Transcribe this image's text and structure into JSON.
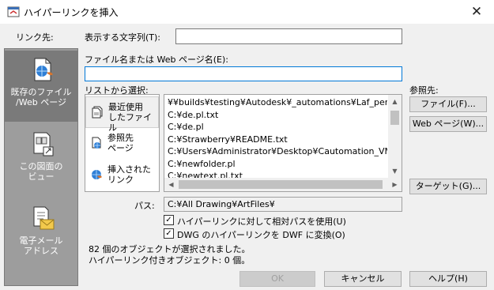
{
  "window": {
    "title": "ハイパーリンクを挿入"
  },
  "sidebar": {
    "header": "リンク先:",
    "items": [
      {
        "label1": "既存のファイル",
        "label2": "/Web ページ"
      },
      {
        "label1": "この図面の",
        "label2": "ビュー"
      },
      {
        "label1": "電子メール",
        "label2": "アドレス"
      }
    ]
  },
  "display_text": {
    "label": "表示する文字列(T):",
    "value": ""
  },
  "filename": {
    "label": "ファイル名または Web ページ名(E):",
    "value": ""
  },
  "select_label": "リストから選択:",
  "browse_label": "参照先:",
  "list_panel": [
    {
      "line1": "最近使用",
      "line2": "したファイル"
    },
    {
      "line1": "参照先",
      "line2": "ページ"
    },
    {
      "line1": "挿入された",
      "line2": "リンク"
    }
  ],
  "file_list": [
    "¥¥builds¥testing¥Autodesk¥_automations¥Laf_performa",
    "C:¥de.pl.txt",
    "C:¥de.pl",
    "C:¥Strawberry¥README.txt",
    "C:¥Users¥Administrator¥Desktop¥Cautomation_VMWA",
    "C:¥newfolder.pl",
    "C:¥newtext.pl.txt"
  ],
  "buttons": {
    "file": "ファイル(F)...",
    "web_page": "Web ページ(W)...",
    "target": "ターゲット(G)...",
    "ok": "OK",
    "cancel": "キャンセル",
    "help": "ヘルプ(H)"
  },
  "path": {
    "label": "パス:",
    "value": "C:¥All Drawing¥ArtFiles¥"
  },
  "checkboxes": [
    {
      "label": "ハイパーリンクに対して相対パスを使用(U)",
      "checked": true
    },
    {
      "label": "DWG のハイパーリンクを DWF に変換(O)",
      "checked": true
    }
  ],
  "status": {
    "line1": "82 個のオブジェクトが選択されました。",
    "line2": "ハイパーリンク付きオブジェクト: 0 個。"
  },
  "icons": {
    "app": "hyperlink-app-icon",
    "close": "close-icon",
    "existing_file": "file-globe-icon",
    "drawing_view": "drawing-view-icon",
    "email": "email-icon",
    "recent_files": "recent-files-icon",
    "browsed_pages": "browsed-pages-icon",
    "inserted_links": "inserted-links-icon"
  },
  "colors": {
    "sidebar_bg": "#9d9d9d",
    "sidebar_selected": "#7a7a7a",
    "focus_border": "#0078d7"
  }
}
